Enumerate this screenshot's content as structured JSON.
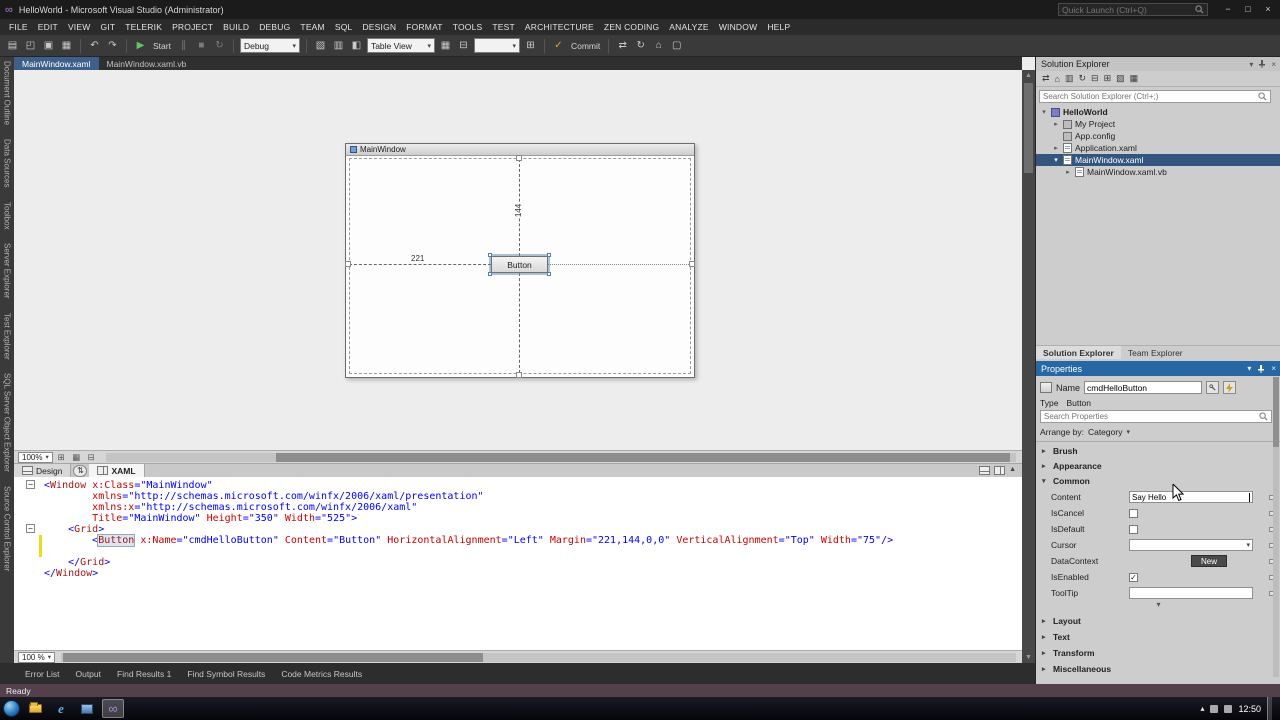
{
  "icons": {
    "infinity": "∞",
    "min": "−",
    "max": "□",
    "close": "×",
    "new": "▤",
    "open": "◰",
    "save": "▣",
    "save_all": "▦",
    "undo": "↶",
    "redo": "↷",
    "start": "▶",
    "pause": "∥",
    "stop": "■",
    "restart": "↻",
    "check": "✓",
    "caret": "▾",
    "chevron_right": "▸",
    "chevron_down": "▾",
    "home": "⌂",
    "sync": "⇄",
    "refresh": "↻",
    "collapse": "⊟",
    "expand": "⊞",
    "files": "▥",
    "grid": "▦",
    "swap": "⇅",
    "up": "▲",
    "down": "▼",
    "tray_up": "▴",
    "minus": "−",
    "box": "▢",
    "gear_sq": "▧",
    "split": "◧",
    "ie": "e"
  },
  "titlebar": {
    "title": "HelloWorld - Microsoft Visual Studio (Administrator)",
    "quick_launch": "Quick Launch (Ctrl+Q)"
  },
  "menubar": {
    "items": [
      "FILE",
      "EDIT",
      "VIEW",
      "GIT",
      "TELERIK",
      "PROJECT",
      "BUILD",
      "DEBUG",
      "TEAM",
      "SQL",
      "DESIGN",
      "FORMAT",
      "TOOLS",
      "TEST",
      "ARCHITECTURE",
      "ZEN CODING",
      "ANALYZE",
      "WINDOW",
      "HELP"
    ]
  },
  "toolbar": {
    "debug_config": "Debug",
    "start_label": "Start",
    "view_combo": "Table View",
    "commit_label": "Commit"
  },
  "side_tabs": {
    "items": [
      "Document Outline",
      "Data Sources",
      "Toolbox",
      "Server Explorer",
      "Test Explorer",
      "SQL Server Object Explorer",
      "Source Control Explorer"
    ]
  },
  "doc_tabs": {
    "items": [
      {
        "label": "MainWindow.xaml"
      },
      {
        "label": "MainWindow.xaml.vb"
      }
    ]
  },
  "designer": {
    "window_title": "MainWindow",
    "button_label": "Button",
    "dim_top": "144",
    "dim_left": "221",
    "zoom": "100%",
    "design_tab": "Design",
    "xaml_tab": "XAML"
  },
  "xaml": {
    "zoom": "100 %",
    "lines": [
      [
        [
          "d",
          "<"
        ],
        [
          "e",
          "Window"
        ],
        [
          "t",
          " "
        ],
        [
          "a",
          "x:Class"
        ],
        [
          "d",
          "="
        ],
        [
          "v",
          "\"MainWindow\""
        ]
      ],
      [
        [
          "t",
          "        "
        ],
        [
          "a",
          "xmlns"
        ],
        [
          "d",
          "="
        ],
        [
          "v",
          "\"http://schemas.microsoft.com/winfx/2006/xaml/presentation\""
        ]
      ],
      [
        [
          "t",
          "        "
        ],
        [
          "a",
          "xmlns:x"
        ],
        [
          "d",
          "="
        ],
        [
          "v",
          "\"http://schemas.microsoft.com/winfx/2006/xaml\""
        ]
      ],
      [
        [
          "t",
          "        "
        ],
        [
          "a",
          "Title"
        ],
        [
          "d",
          "="
        ],
        [
          "v",
          "\"MainWindow\""
        ],
        [
          "t",
          " "
        ],
        [
          "a",
          "Height"
        ],
        [
          "d",
          "="
        ],
        [
          "v",
          "\"350\""
        ],
        [
          "t",
          " "
        ],
        [
          "a",
          "Width"
        ],
        [
          "d",
          "="
        ],
        [
          "v",
          "\"525\""
        ],
        [
          "d",
          ">"
        ]
      ],
      [
        [
          "t",
          "    "
        ],
        [
          "d",
          "<"
        ],
        [
          "e",
          "Grid"
        ],
        [
          "d",
          ">"
        ]
      ],
      [
        [
          "t",
          "        "
        ],
        [
          "d",
          "<"
        ],
        [
          "es",
          "Button"
        ],
        [
          "t",
          " "
        ],
        [
          "a",
          "x:Name"
        ],
        [
          "d",
          "="
        ],
        [
          "v",
          "\"cmdHelloButton\""
        ],
        [
          "t",
          " "
        ],
        [
          "a",
          "Content"
        ],
        [
          "d",
          "="
        ],
        [
          "v",
          "\"Button\""
        ],
        [
          "t",
          " "
        ],
        [
          "a",
          "HorizontalAlignment"
        ],
        [
          "d",
          "="
        ],
        [
          "v",
          "\"Left\""
        ],
        [
          "t",
          " "
        ],
        [
          "a",
          "Margin"
        ],
        [
          "d",
          "="
        ],
        [
          "v",
          "\"221,144,0,0\""
        ],
        [
          "t",
          " "
        ],
        [
          "a",
          "VerticalAlignment"
        ],
        [
          "d",
          "="
        ],
        [
          "v",
          "\"Top\""
        ],
        [
          "t",
          " "
        ],
        [
          "a",
          "Width"
        ],
        [
          "d",
          "="
        ],
        [
          "v",
          "\"75\""
        ],
        [
          "d",
          "/>"
        ]
      ],
      [
        [
          "t",
          ""
        ]
      ],
      [
        [
          "t",
          "    "
        ],
        [
          "d",
          "</"
        ],
        [
          "e",
          "Grid"
        ],
        [
          "d",
          ">"
        ]
      ],
      [
        [
          "d",
          "</"
        ],
        [
          "e",
          "Window"
        ],
        [
          "d",
          ">"
        ]
      ]
    ]
  },
  "solution_explorer": {
    "title": "Solution Explorer",
    "search_placeholder": "Search Solution Explorer (Ctrl+;)",
    "items": [
      {
        "label": "HelloWorld"
      },
      {
        "label": "My Project"
      },
      {
        "label": "App.config"
      },
      {
        "label": "Application.xaml"
      },
      {
        "label": "MainWindow.xaml"
      },
      {
        "label": "MainWindow.xaml.vb"
      }
    ],
    "tabs": [
      "Solution Explorer",
      "Team Explorer"
    ]
  },
  "properties": {
    "title": "Properties",
    "name_label": "Name",
    "name_value": "cmdHelloButton",
    "type_label": "Type",
    "type_value": "Button",
    "search_placeholder": "Search Properties",
    "arrange_label": "Arrange by:",
    "arrange_value": "Category",
    "cat_brush": "Brush",
    "cat_appearance": "Appearance",
    "cat_common": "Common",
    "cat_layout": "Layout",
    "cat_text": "Text",
    "cat_transform": "Transform",
    "cat_misc": "Miscellaneous",
    "content_label": "Content",
    "content_value": "Say Hello",
    "iscancel_label": "IsCancel",
    "isdefault_label": "IsDefault",
    "cursor_label": "Cursor",
    "datacontext_label": "DataContext",
    "datacontext_button": "New",
    "isenabled_label": "IsEnabled",
    "tooltip_label": "ToolTip"
  },
  "bottom_tabs": {
    "items": [
      "Error List",
      "Output",
      "Find Results 1",
      "Find Symbol Results",
      "Code Metrics Results"
    ]
  },
  "statusbar": {
    "ready": "Ready"
  },
  "taskbar": {
    "clock": "12:50"
  }
}
